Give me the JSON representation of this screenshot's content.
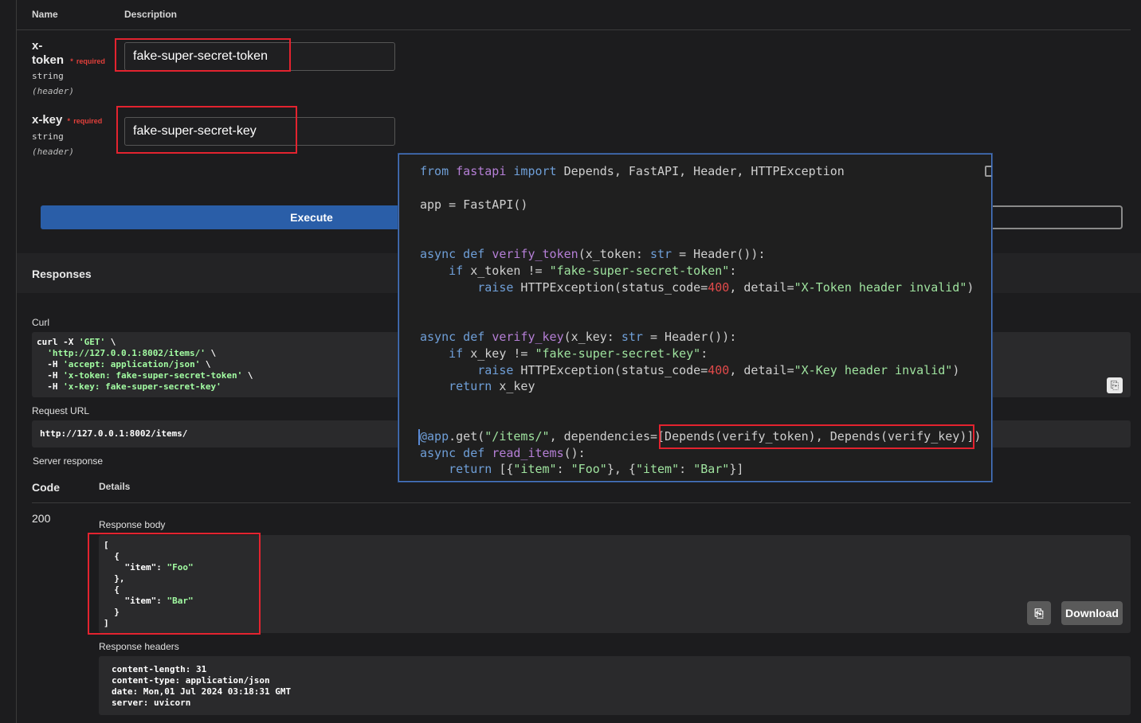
{
  "params": {
    "header_name": "Name",
    "header_desc": "Description",
    "items": [
      {
        "name1": "x-",
        "name2": "token",
        "required_mark": "*",
        "required_label": "required",
        "type": "string",
        "location": "(header)",
        "value": "fake-super-secret-token"
      },
      {
        "name1": "x-key",
        "name2": "",
        "required_mark": "*",
        "required_label": "required",
        "type": "string",
        "location": "(header)",
        "value": "fake-super-secret-key"
      }
    ]
  },
  "execute_label": "Execute",
  "responses_title": "Responses",
  "curl": {
    "label": "Curl",
    "lines": [
      [
        "curl -X ",
        "'GET'",
        " \\"
      ],
      [
        "  ",
        "'http://127.0.0.1:8002/items/'",
        " \\"
      ],
      [
        "  -H ",
        "'accept: application/json'",
        " \\"
      ],
      [
        "  -H ",
        "'x-token: fake-super-secret-token'",
        " \\"
      ],
      [
        "  -H ",
        "'x-key: fake-super-secret-key'",
        ""
      ]
    ]
  },
  "request_url": {
    "label": "Request URL",
    "value": "http://127.0.0.1:8002/items/"
  },
  "server_response": {
    "label": "Server response",
    "code_header": "Code",
    "details_header": "Details",
    "code": "200",
    "body_label": "Response body",
    "body_lines": [
      [
        "[",
        "",
        ""
      ],
      [
        "  {",
        "",
        ""
      ],
      [
        "    \"item\": ",
        "\"Foo\"",
        ""
      ],
      [
        "  },",
        "",
        ""
      ],
      [
        "  {",
        "",
        ""
      ],
      [
        "    \"item\": ",
        "\"Bar\"",
        ""
      ],
      [
        "  }",
        "",
        ""
      ],
      [
        "]",
        "",
        ""
      ]
    ],
    "download_label": "Download",
    "headers_label": "Response headers",
    "headers_lines": [
      "content-length: 31",
      "content-type: application/json",
      "date: Mon,01 Jul 2024 03:18:31 GMT",
      "server: uvicorn"
    ]
  },
  "code_overlay": {
    "lines": [
      [
        [
          "kw",
          "from"
        ],
        [
          "t",
          " "
        ],
        [
          "fn",
          "fastapi"
        ],
        [
          "t",
          " "
        ],
        [
          "kw",
          "import"
        ],
        [
          "t",
          " Depends, FastAPI, Header, HTTPException"
        ]
      ],
      [],
      [
        [
          "t",
          "app = FastAPI()"
        ]
      ],
      [],
      [],
      [
        [
          "kw",
          "async def"
        ],
        [
          "t",
          " "
        ],
        [
          "fn",
          "verify_token"
        ],
        [
          "t",
          "(x_token: "
        ],
        [
          "kw",
          "str"
        ],
        [
          "t",
          " = Header()):"
        ]
      ],
      [
        [
          "t",
          "    "
        ],
        [
          "kw",
          "if"
        ],
        [
          "t",
          " x_token != "
        ],
        [
          "ps",
          "\"fake-super-secret-token\""
        ],
        [
          "t",
          ":"
        ]
      ],
      [
        [
          "t",
          "        "
        ],
        [
          "kw",
          "raise"
        ],
        [
          "t",
          " HTTPException(status_code="
        ],
        [
          "num",
          "400"
        ],
        [
          "t",
          ", detail="
        ],
        [
          "ps",
          "\"X-Token header invalid\""
        ],
        [
          "t",
          ")"
        ]
      ],
      [],
      [],
      [
        [
          "kw",
          "async def"
        ],
        [
          "t",
          " "
        ],
        [
          "fn",
          "verify_key"
        ],
        [
          "t",
          "(x_key: "
        ],
        [
          "kw",
          "str"
        ],
        [
          "t",
          " = Header()):"
        ]
      ],
      [
        [
          "t",
          "    "
        ],
        [
          "kw",
          "if"
        ],
        [
          "t",
          " x_key != "
        ],
        [
          "ps",
          "\"fake-super-secret-key\""
        ],
        [
          "t",
          ":"
        ]
      ],
      [
        [
          "t",
          "        "
        ],
        [
          "kw",
          "raise"
        ],
        [
          "t",
          " HTTPException(status_code="
        ],
        [
          "num",
          "400"
        ],
        [
          "t",
          ", detail="
        ],
        [
          "ps",
          "\"X-Key header invalid\""
        ],
        [
          "t",
          ")"
        ]
      ],
      [
        [
          "t",
          "    "
        ],
        [
          "kw",
          "return"
        ],
        [
          "t",
          " x_key"
        ]
      ],
      [],
      [],
      [
        [
          "dec",
          "@app"
        ],
        [
          "t",
          ".get("
        ],
        [
          "ps",
          "\"/items/\""
        ],
        [
          "t",
          ", dependencies=[Depends(verify_token), Depends(verify_key)])"
        ]
      ],
      [
        [
          "kw",
          "async def"
        ],
        [
          "t",
          " "
        ],
        [
          "fn",
          "read_items"
        ],
        [
          "t",
          "():"
        ]
      ],
      [
        [
          "t",
          "    "
        ],
        [
          "kw",
          "return"
        ],
        [
          "t",
          " [{"
        ],
        [
          "ps",
          "\"item\""
        ],
        [
          "t",
          ": "
        ],
        [
          "ps",
          "\"Foo\""
        ],
        [
          "t",
          "}, {"
        ],
        [
          "ps",
          "\"item\""
        ],
        [
          "t",
          ": "
        ],
        [
          "ps",
          "\"Bar\""
        ],
        [
          "t",
          "}]"
        ]
      ]
    ]
  }
}
